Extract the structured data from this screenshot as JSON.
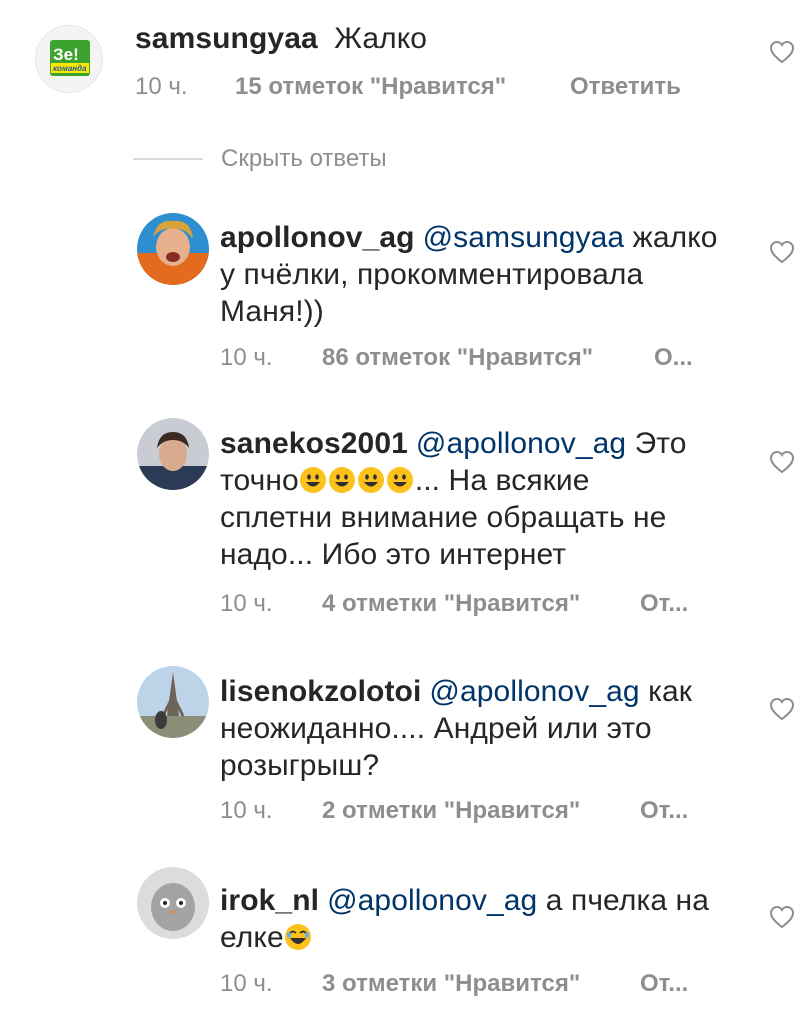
{
  "comments": [
    {
      "username": "samsungyaa",
      "parts": [
        " Жалко"
      ],
      "time": "10 ч.",
      "likes": "15 отметок \"Нравится\"",
      "reply": "Ответить"
    },
    {
      "username": "apollonov_ag",
      "mention": "@samsungyaa",
      "line1": " жалко",
      "line2": "у пчёлки, прокомментировала",
      "line3": "Маня!))",
      "time": "10 ч.",
      "likes": "86 отметок \"Нравится\"",
      "reply": "О..."
    },
    {
      "username": "sanekos2001",
      "mention": "@apollonov_ag",
      "line1": "  Это",
      "line2_pre": "точно",
      "line2_post": "... На всякие",
      "line3": "сплетни внимание обращать не",
      "line4": "надо... Ибо это интернет",
      "time": "10 ч.",
      "likes": "4 отметки \"Нравится\"",
      "reply": "От..."
    },
    {
      "username": "lisenokzolotoi",
      "mention": "@apollonov_ag",
      "line1": " как",
      "line2": "неожиданно.... Андрей или это",
      "line3": "розыгрыш?",
      "time": "10 ч.",
      "likes": "2 отметки \"Нравится\"",
      "reply": "От..."
    },
    {
      "username": "irok_nl",
      "mention": "@apollonov_ag",
      "line1": " а пчелка на",
      "line2": "елке",
      "time": "10 ч.",
      "likes": "3 отметки \"Нравится\"",
      "reply": "От..."
    }
  ],
  "hide_replies": "Скрыть ответы",
  "logo": {
    "line1": "Зе!",
    "line2": "команда"
  },
  "icons": {
    "like": "heart-icon",
    "emoji": "grinning-face-icon",
    "emoji2": "laughing-face-icon"
  }
}
